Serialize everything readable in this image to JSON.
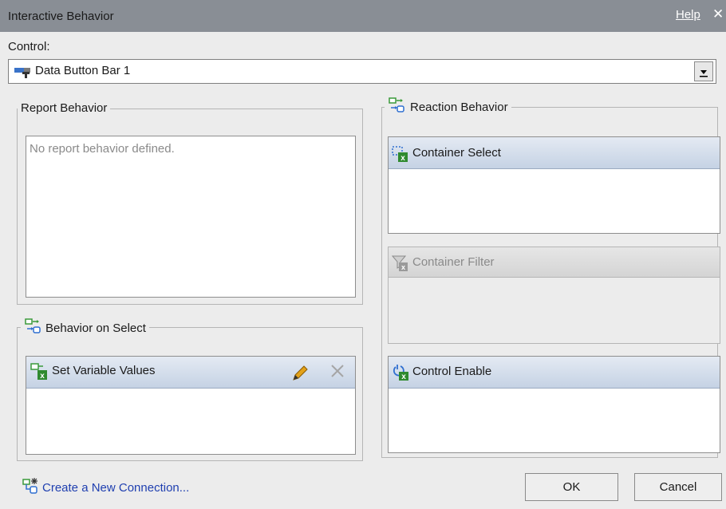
{
  "window": {
    "title": "Interactive Behavior",
    "help_label": "Help",
    "close_glyph": "✕"
  },
  "control": {
    "label": "Control:",
    "selected_value": "Data Button Bar 1",
    "icon": "button-bar-icon",
    "dropdown_icon": "chevron-down-icon"
  },
  "report_behavior": {
    "legend": "Report Behavior",
    "empty_text": "No report behavior defined."
  },
  "behavior_on_select": {
    "legend": "Behavior on Select",
    "legend_icon": "connection-icon",
    "items": [
      {
        "label": "Set Variable Values",
        "icon": "set-variable-icon"
      }
    ],
    "edit_icon": "pencil-icon",
    "delete_icon": "delete-x-icon"
  },
  "reaction_behavior": {
    "legend": "Reaction Behavior",
    "legend_icon": "reaction-icon",
    "items": [
      {
        "label": "Container Select",
        "icon": "container-select-icon",
        "enabled": true
      },
      {
        "label": "Container Filter",
        "icon": "container-filter-icon",
        "enabled": false
      },
      {
        "label": "Control Enable",
        "icon": "control-enable-icon",
        "enabled": true
      }
    ]
  },
  "footer": {
    "new_connection_label": "Create a New Connection...",
    "new_connection_icon": "new-connection-icon",
    "ok_label": "OK",
    "cancel_label": "Cancel"
  },
  "colors": {
    "titlebar": "#898e95",
    "panel": "#ececec",
    "header_gradient_top": "#e4eaf3",
    "header_gradient_bottom": "#c5d2e4",
    "link": "#1f3fb0"
  }
}
